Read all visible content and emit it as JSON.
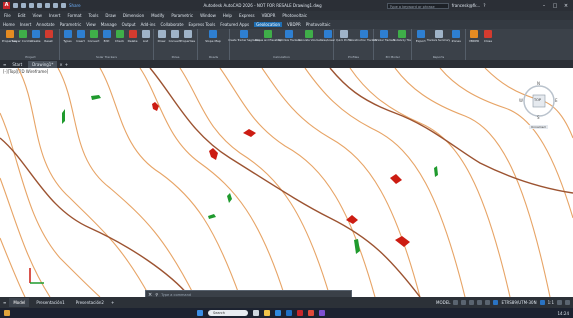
{
  "titlebar": {
    "app_icon": "A",
    "share_label": "Share",
    "title": "Autodesk AutoCAD 2026 - NOT FOR RESALE    Drawing1.dwg",
    "search_placeholder": "Type a keyword or phrase",
    "user": "francesk@fk...",
    "help": "?"
  },
  "menubar": {
    "items": [
      "File",
      "Edit",
      "View",
      "Insert",
      "Format",
      "Tools",
      "Draw",
      "Dimension",
      "Modify",
      "Parametric",
      "Window",
      "Help",
      "Express",
      "VBDPR",
      "Photovoltaic"
    ]
  },
  "ribbon_tabs": {
    "items": [
      "Home",
      "Insert",
      "Annotate",
      "Parametric",
      "View",
      "Manage",
      "Output",
      "Add-ins",
      "Collaborate",
      "Express Tools",
      "Featured Apps",
      "Geolocation",
      "VBDPR",
      "Photovoltaic"
    ],
    "active_index": 11
  },
  "ribbon": {
    "panels": [
      {
        "title": "Project",
        "tools": [
          "Properties",
          "Layer Control",
          "Create",
          "Reset"
        ]
      },
      {
        "title": "Solar Trackers",
        "tools": [
          "Types",
          "Insert",
          "Convert",
          "Edit",
          "Check",
          "Delete",
          "List"
        ]
      },
      {
        "title": "Poles",
        "tools": [
          "Draw",
          "Convert",
          "Properties"
        ]
      },
      {
        "title": "Roads",
        "tools": [
          "Slope Map"
        ]
      },
      {
        "title": "Calculation",
        "tools": [
          "Create Tracker Segments",
          "Slopes and Elevation",
          "Optimize Trackers",
          "Calculate Volume",
          "Raise/Lower"
        ]
      },
      {
        "title": "Profiles",
        "tools": [
          "Quick Profile",
          "Construction Trackers"
        ]
      },
      {
        "title": "3D Model",
        "tools": [
          "3D Solar Trackers",
          "Models by Tile"
        ]
      },
      {
        "title": "Reports",
        "tools": [
          "Export",
          "Trackers Summary",
          "Zones"
        ]
      },
      {
        "title": "",
        "tools": [
          "VBDPR",
          "Close"
        ]
      }
    ],
    "colors": {
      "accent_blue": "#2e7fd1",
      "tool_green": "#3fae49",
      "tool_red": "#d33b2f",
      "tool_orange": "#e48b22"
    }
  },
  "document_tabs": {
    "items": [
      "Start",
      "Drawing1*"
    ],
    "add": "+"
  },
  "drawing": {
    "view_label": "[-][Top][2D Wireframe]",
    "viewcube": {
      "top_label": "TOP",
      "n": "N",
      "s": "S",
      "e": "E",
      "w": "W",
      "wcs": "Unnamed"
    },
    "colors": {
      "contour": "#e7a466",
      "major_contour": "#9c5331",
      "marker_red": "#cc1c12",
      "marker_green": "#1f9a2d"
    }
  },
  "command_line": {
    "placeholder": "Type a command"
  },
  "layout_tabs": {
    "items": [
      "Model",
      "Presentación1",
      "Presentación2"
    ],
    "add": "+",
    "status_mode": "MODEL",
    "coords": "ETRS89/UTM-30N",
    "scale": "1:1"
  },
  "taskbar": {
    "search_placeholder": "Search",
    "time": "14:24"
  }
}
